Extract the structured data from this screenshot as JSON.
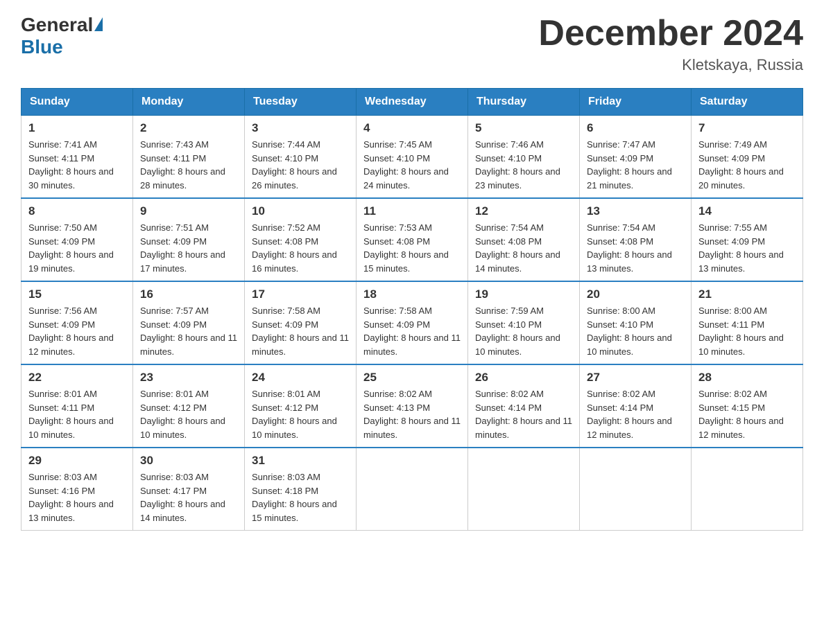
{
  "header": {
    "logo_general": "General",
    "logo_blue": "Blue",
    "month_title": "December 2024",
    "location": "Kletskaya, Russia"
  },
  "days_of_week": [
    "Sunday",
    "Monday",
    "Tuesday",
    "Wednesday",
    "Thursday",
    "Friday",
    "Saturday"
  ],
  "weeks": [
    [
      {
        "day": "1",
        "sunrise": "7:41 AM",
        "sunset": "4:11 PM",
        "daylight": "8 hours and 30 minutes."
      },
      {
        "day": "2",
        "sunrise": "7:43 AM",
        "sunset": "4:11 PM",
        "daylight": "8 hours and 28 minutes."
      },
      {
        "day": "3",
        "sunrise": "7:44 AM",
        "sunset": "4:10 PM",
        "daylight": "8 hours and 26 minutes."
      },
      {
        "day": "4",
        "sunrise": "7:45 AM",
        "sunset": "4:10 PM",
        "daylight": "8 hours and 24 minutes."
      },
      {
        "day": "5",
        "sunrise": "7:46 AM",
        "sunset": "4:10 PM",
        "daylight": "8 hours and 23 minutes."
      },
      {
        "day": "6",
        "sunrise": "7:47 AM",
        "sunset": "4:09 PM",
        "daylight": "8 hours and 21 minutes."
      },
      {
        "day": "7",
        "sunrise": "7:49 AM",
        "sunset": "4:09 PM",
        "daylight": "8 hours and 20 minutes."
      }
    ],
    [
      {
        "day": "8",
        "sunrise": "7:50 AM",
        "sunset": "4:09 PM",
        "daylight": "8 hours and 19 minutes."
      },
      {
        "day": "9",
        "sunrise": "7:51 AM",
        "sunset": "4:09 PM",
        "daylight": "8 hours and 17 minutes."
      },
      {
        "day": "10",
        "sunrise": "7:52 AM",
        "sunset": "4:08 PM",
        "daylight": "8 hours and 16 minutes."
      },
      {
        "day": "11",
        "sunrise": "7:53 AM",
        "sunset": "4:08 PM",
        "daylight": "8 hours and 15 minutes."
      },
      {
        "day": "12",
        "sunrise": "7:54 AM",
        "sunset": "4:08 PM",
        "daylight": "8 hours and 14 minutes."
      },
      {
        "day": "13",
        "sunrise": "7:54 AM",
        "sunset": "4:08 PM",
        "daylight": "8 hours and 13 minutes."
      },
      {
        "day": "14",
        "sunrise": "7:55 AM",
        "sunset": "4:09 PM",
        "daylight": "8 hours and 13 minutes."
      }
    ],
    [
      {
        "day": "15",
        "sunrise": "7:56 AM",
        "sunset": "4:09 PM",
        "daylight": "8 hours and 12 minutes."
      },
      {
        "day": "16",
        "sunrise": "7:57 AM",
        "sunset": "4:09 PM",
        "daylight": "8 hours and 11 minutes."
      },
      {
        "day": "17",
        "sunrise": "7:58 AM",
        "sunset": "4:09 PM",
        "daylight": "8 hours and 11 minutes."
      },
      {
        "day": "18",
        "sunrise": "7:58 AM",
        "sunset": "4:09 PM",
        "daylight": "8 hours and 11 minutes."
      },
      {
        "day": "19",
        "sunrise": "7:59 AM",
        "sunset": "4:10 PM",
        "daylight": "8 hours and 10 minutes."
      },
      {
        "day": "20",
        "sunrise": "8:00 AM",
        "sunset": "4:10 PM",
        "daylight": "8 hours and 10 minutes."
      },
      {
        "day": "21",
        "sunrise": "8:00 AM",
        "sunset": "4:11 PM",
        "daylight": "8 hours and 10 minutes."
      }
    ],
    [
      {
        "day": "22",
        "sunrise": "8:01 AM",
        "sunset": "4:11 PM",
        "daylight": "8 hours and 10 minutes."
      },
      {
        "day": "23",
        "sunrise": "8:01 AM",
        "sunset": "4:12 PM",
        "daylight": "8 hours and 10 minutes."
      },
      {
        "day": "24",
        "sunrise": "8:01 AM",
        "sunset": "4:12 PM",
        "daylight": "8 hours and 10 minutes."
      },
      {
        "day": "25",
        "sunrise": "8:02 AM",
        "sunset": "4:13 PM",
        "daylight": "8 hours and 11 minutes."
      },
      {
        "day": "26",
        "sunrise": "8:02 AM",
        "sunset": "4:14 PM",
        "daylight": "8 hours and 11 minutes."
      },
      {
        "day": "27",
        "sunrise": "8:02 AM",
        "sunset": "4:14 PM",
        "daylight": "8 hours and 12 minutes."
      },
      {
        "day": "28",
        "sunrise": "8:02 AM",
        "sunset": "4:15 PM",
        "daylight": "8 hours and 12 minutes."
      }
    ],
    [
      {
        "day": "29",
        "sunrise": "8:03 AM",
        "sunset": "4:16 PM",
        "daylight": "8 hours and 13 minutes."
      },
      {
        "day": "30",
        "sunrise": "8:03 AM",
        "sunset": "4:17 PM",
        "daylight": "8 hours and 14 minutes."
      },
      {
        "day": "31",
        "sunrise": "8:03 AM",
        "sunset": "4:18 PM",
        "daylight": "8 hours and 15 minutes."
      },
      null,
      null,
      null,
      null
    ]
  ],
  "labels": {
    "sunrise": "Sunrise:",
    "sunset": "Sunset:",
    "daylight": "Daylight:"
  }
}
